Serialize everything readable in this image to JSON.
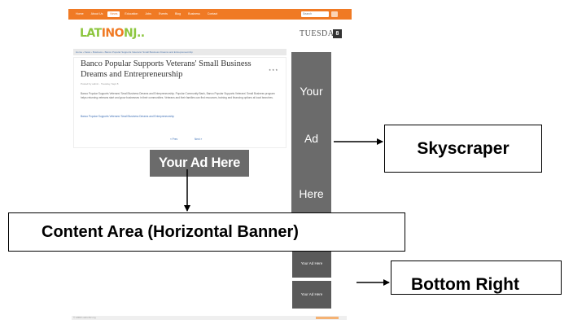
{
  "site": {
    "nav_items": [
      "Home",
      "About Us",
      "News",
      "Education",
      "Jobs",
      "Events",
      "Blog",
      "Business",
      "Contact"
    ],
    "active_nav": "News",
    "search_placeholder": "Search",
    "logo": {
      "part1": "LAT",
      "part2": "INO",
      "part3": "NJ.."
    },
    "day_label": "TUESDAY",
    "day_number": "8",
    "breadcrumb": "Home › News › Business › Banco Popular Supports Veterans' Small Business Dreams and Entrepreneurship",
    "article": {
      "title": "Banco Popular Supports Veterans' Small Business Dreams and Entrepreneurship",
      "meta": "Posted by admin · Tuesday, Sept 8",
      "rating": "★ ★ ★",
      "body": "Banco Popular Supports Veterans' Small Business Dreams and Entrepreneurship. Popular Community Bank, Banco Popular Supports Veterans' Small Business program helps returning veterans start and grow businesses in their communities. Veterans and their families can find resources, training and financing options at local branches.",
      "link": "Banco Popular Supports Veterans' Small Business Dreams and Entrepreneurship",
      "prev_label": "« Prev",
      "next_label": "Next »"
    },
    "banner_ad": "Your Ad Here",
    "skyscraper_words": [
      "Your",
      "Ad",
      "Here"
    ],
    "small_ads": [
      "Your Ad Here",
      "Your Ad Here"
    ],
    "footer_text": "© 2009 LatinoNJ.org"
  },
  "annotations": {
    "skyscraper": "Skyscraper",
    "content_area": "Content Area (Horizontal Banner)",
    "bottom_right": "Bottom Right"
  },
  "colors": {
    "nav_orange": "#f07a24",
    "logo_green": "#8dc63f",
    "ad_gray": "#6b6b6b",
    "link_blue": "#3d6fb6"
  }
}
